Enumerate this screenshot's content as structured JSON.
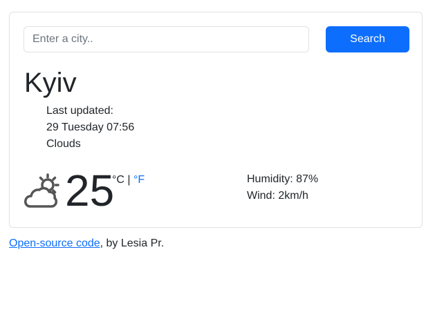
{
  "search": {
    "placeholder": "Enter a city..",
    "value": "",
    "button_label": "Search"
  },
  "city": {
    "name": "Kyiv"
  },
  "details": {
    "last_updated_label": "Last updated:",
    "date_time": "29 Tuesday 07:56",
    "description": "Clouds"
  },
  "current": {
    "icon": "partly-cloudy-icon",
    "temperature": "25",
    "unit_c": "°C",
    "unit_separator": "|",
    "unit_f": "°F"
  },
  "conditions": {
    "humidity": "Humidity: 87%",
    "wind": "Wind: 2km/h"
  },
  "footer": {
    "link_text": "Open-source code",
    "suffix": ", by Lesia Pr."
  },
  "colors": {
    "accent": "#0d6efd",
    "text": "#212529",
    "border": "#dee2e6",
    "icon": "#555555"
  }
}
